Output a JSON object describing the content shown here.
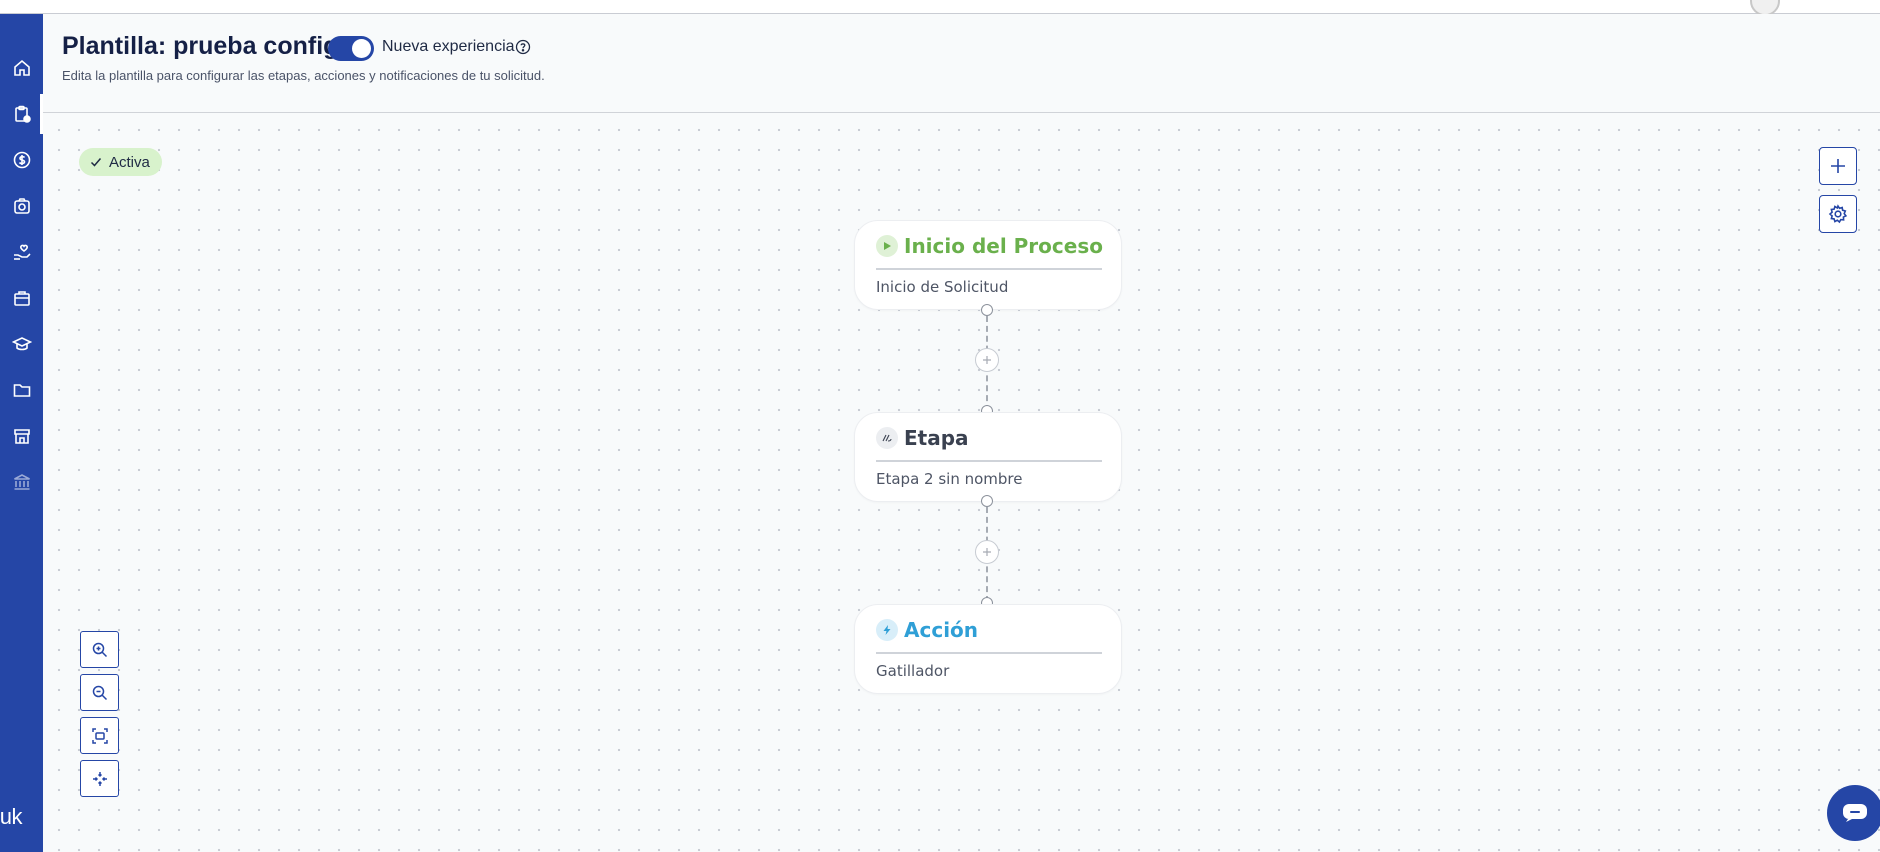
{
  "header": {
    "title": "Plantilla: prueba config",
    "toggle_label": "Nueva experiencia",
    "toggle_on": true,
    "subtitle": "Edita la plantilla para configurar las etapas, acciones y notificaciones de tu solicitud."
  },
  "sidebar": {
    "items": [
      {
        "icon": "home-icon",
        "active": false
      },
      {
        "icon": "clipboard-settings-icon",
        "active": true
      },
      {
        "icon": "dollar-icon",
        "active": false
      },
      {
        "icon": "camera-icon",
        "active": false
      },
      {
        "icon": "hand-heart-icon",
        "active": false
      },
      {
        "icon": "briefcase-icon",
        "active": false
      },
      {
        "icon": "graduation-cap-icon",
        "active": false
      },
      {
        "icon": "folder-icon",
        "active": false
      },
      {
        "icon": "store-icon",
        "active": false
      },
      {
        "icon": "bank-icon",
        "active": false
      }
    ],
    "logo_text": "buk"
  },
  "canvas": {
    "status_label": "Activa",
    "nodes": [
      {
        "title": "Inicio del Proceso",
        "subtitle": "Inicio de Solicitud",
        "icon": "play-icon",
        "color": "#6ab04c",
        "icon_bg": "#dff1d6"
      },
      {
        "title": "Etapa",
        "subtitle": "Etapa 2 sin nombre",
        "icon": "stage-icon",
        "color": "#3a4150",
        "icon_bg": "#eceef1"
      },
      {
        "title": "Acción",
        "subtitle": "Gatillador",
        "icon": "bolt-icon",
        "color": "#2f9fd6",
        "icon_bg": "#d8eef9"
      }
    ]
  },
  "colors": {
    "brand": "#2546a6",
    "success_bg": "#d8f2cc"
  }
}
